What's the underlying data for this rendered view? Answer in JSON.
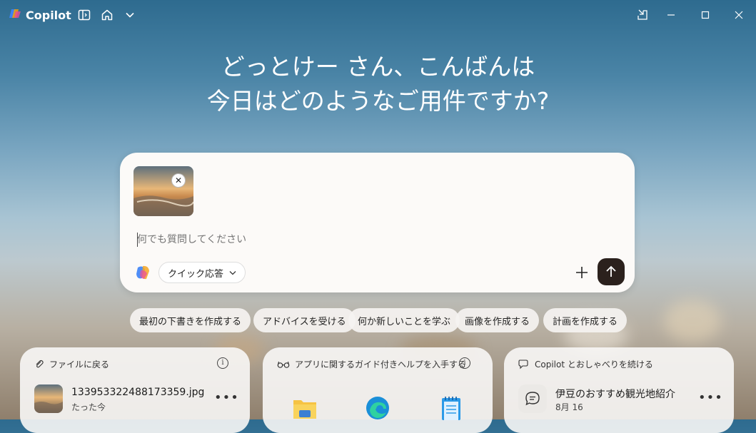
{
  "app": {
    "name": "Copilot"
  },
  "greeting": {
    "line1": "どっとけー さん、こんばんは",
    "line2": "今日はどのようなご用件ですか?"
  },
  "composer": {
    "placeholder": "何でも質問してください",
    "mode_label": "クイック応答",
    "attachment_close": "✕"
  },
  "suggestions": [
    "最初の下書きを作成する",
    "アドバイスを受ける",
    "何か新しいことを学ぶ",
    "画像を作成する",
    "計画を作成する"
  ],
  "cards": {
    "files": {
      "title": "ファイルに戻る",
      "item_name": "133953322488173359.jpg",
      "item_time": "たった今"
    },
    "guide": {
      "title": "アプリに関するガイド付きヘルプを入手する"
    },
    "chat": {
      "title": "Copilot とおしゃべりを続ける",
      "item_name": "伊豆のおすすめ観光地紹介",
      "item_date": "8月 16"
    }
  },
  "icons": [
    "copilot-logo-icon",
    "sidebar-toggle-icon",
    "home-icon",
    "chevron-down-icon",
    "restore-pane-icon",
    "minimize-icon",
    "maximize-icon",
    "close-icon",
    "plus-icon",
    "send-arrow-icon",
    "paperclip-icon",
    "glasses-icon",
    "chat-bubble-icon",
    "info-icon",
    "more-icon",
    "folder-icon",
    "edge-icon",
    "notepad-icon"
  ]
}
